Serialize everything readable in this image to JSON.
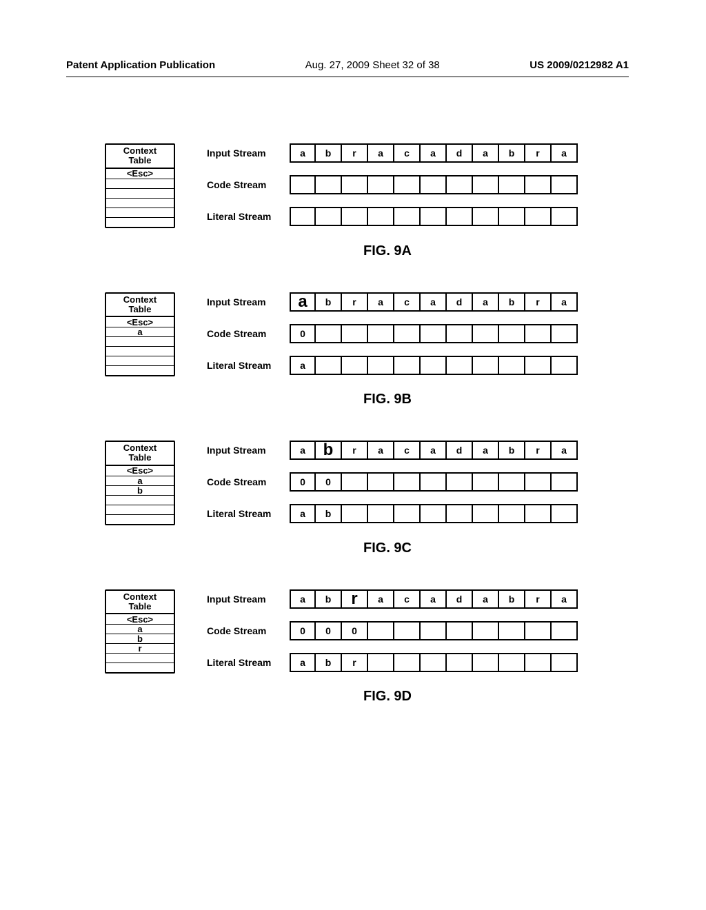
{
  "header": {
    "left": "Patent Application Publication",
    "mid": "Aug. 27, 2009  Sheet 32 of 38",
    "right": "US 2009/0212982 A1"
  },
  "labels": {
    "context_title_l1": "Context",
    "context_title_l2": "Table",
    "input": "Input Stream",
    "code": "Code Stream",
    "literal": "Literal Stream"
  },
  "figures": [
    {
      "id": "fig-9a",
      "caption": "FIG. 9A",
      "context_rows": [
        "<Esc>",
        "",
        "",
        "",
        "",
        ""
      ],
      "highlight": -1,
      "input": [
        "a",
        "b",
        "r",
        "a",
        "c",
        "a",
        "d",
        "a",
        "b",
        "r",
        "a"
      ],
      "code": [
        "",
        "",
        "",
        "",
        "",
        "",
        "",
        "",
        "",
        "",
        ""
      ],
      "literal": [
        "",
        "",
        "",
        "",
        "",
        "",
        "",
        "",
        "",
        "",
        ""
      ]
    },
    {
      "id": "fig-9b",
      "caption": "FIG. 9B",
      "context_rows": [
        "<Esc>",
        "a",
        "",
        "",
        "",
        ""
      ],
      "highlight": 0,
      "input": [
        "a",
        "b",
        "r",
        "a",
        "c",
        "a",
        "d",
        "a",
        "b",
        "r",
        "a"
      ],
      "code": [
        "0",
        "",
        "",
        "",
        "",
        "",
        "",
        "",
        "",
        "",
        ""
      ],
      "literal": [
        "a",
        "",
        "",
        "",
        "",
        "",
        "",
        "",
        "",
        "",
        ""
      ]
    },
    {
      "id": "fig-9c",
      "caption": "FIG. 9C",
      "context_rows": [
        "<Esc>",
        "a",
        "b",
        "",
        "",
        ""
      ],
      "highlight": 1,
      "input": [
        "a",
        "b",
        "r",
        "a",
        "c",
        "a",
        "d",
        "a",
        "b",
        "r",
        "a"
      ],
      "code": [
        "0",
        "0",
        "",
        "",
        "",
        "",
        "",
        "",
        "",
        "",
        ""
      ],
      "literal": [
        "a",
        "b",
        "",
        "",
        "",
        "",
        "",
        "",
        "",
        "",
        ""
      ]
    },
    {
      "id": "fig-9d",
      "caption": "FIG. 9D",
      "context_rows": [
        "<Esc>",
        "a",
        "b",
        "r",
        "",
        ""
      ],
      "highlight": 2,
      "input": [
        "a",
        "b",
        "r",
        "a",
        "c",
        "a",
        "d",
        "a",
        "b",
        "r",
        "a"
      ],
      "code": [
        "0",
        "0",
        "0",
        "",
        "",
        "",
        "",
        "",
        "",
        "",
        ""
      ],
      "literal": [
        "a",
        "b",
        "r",
        "",
        "",
        "",
        "",
        "",
        "",
        "",
        ""
      ]
    }
  ]
}
